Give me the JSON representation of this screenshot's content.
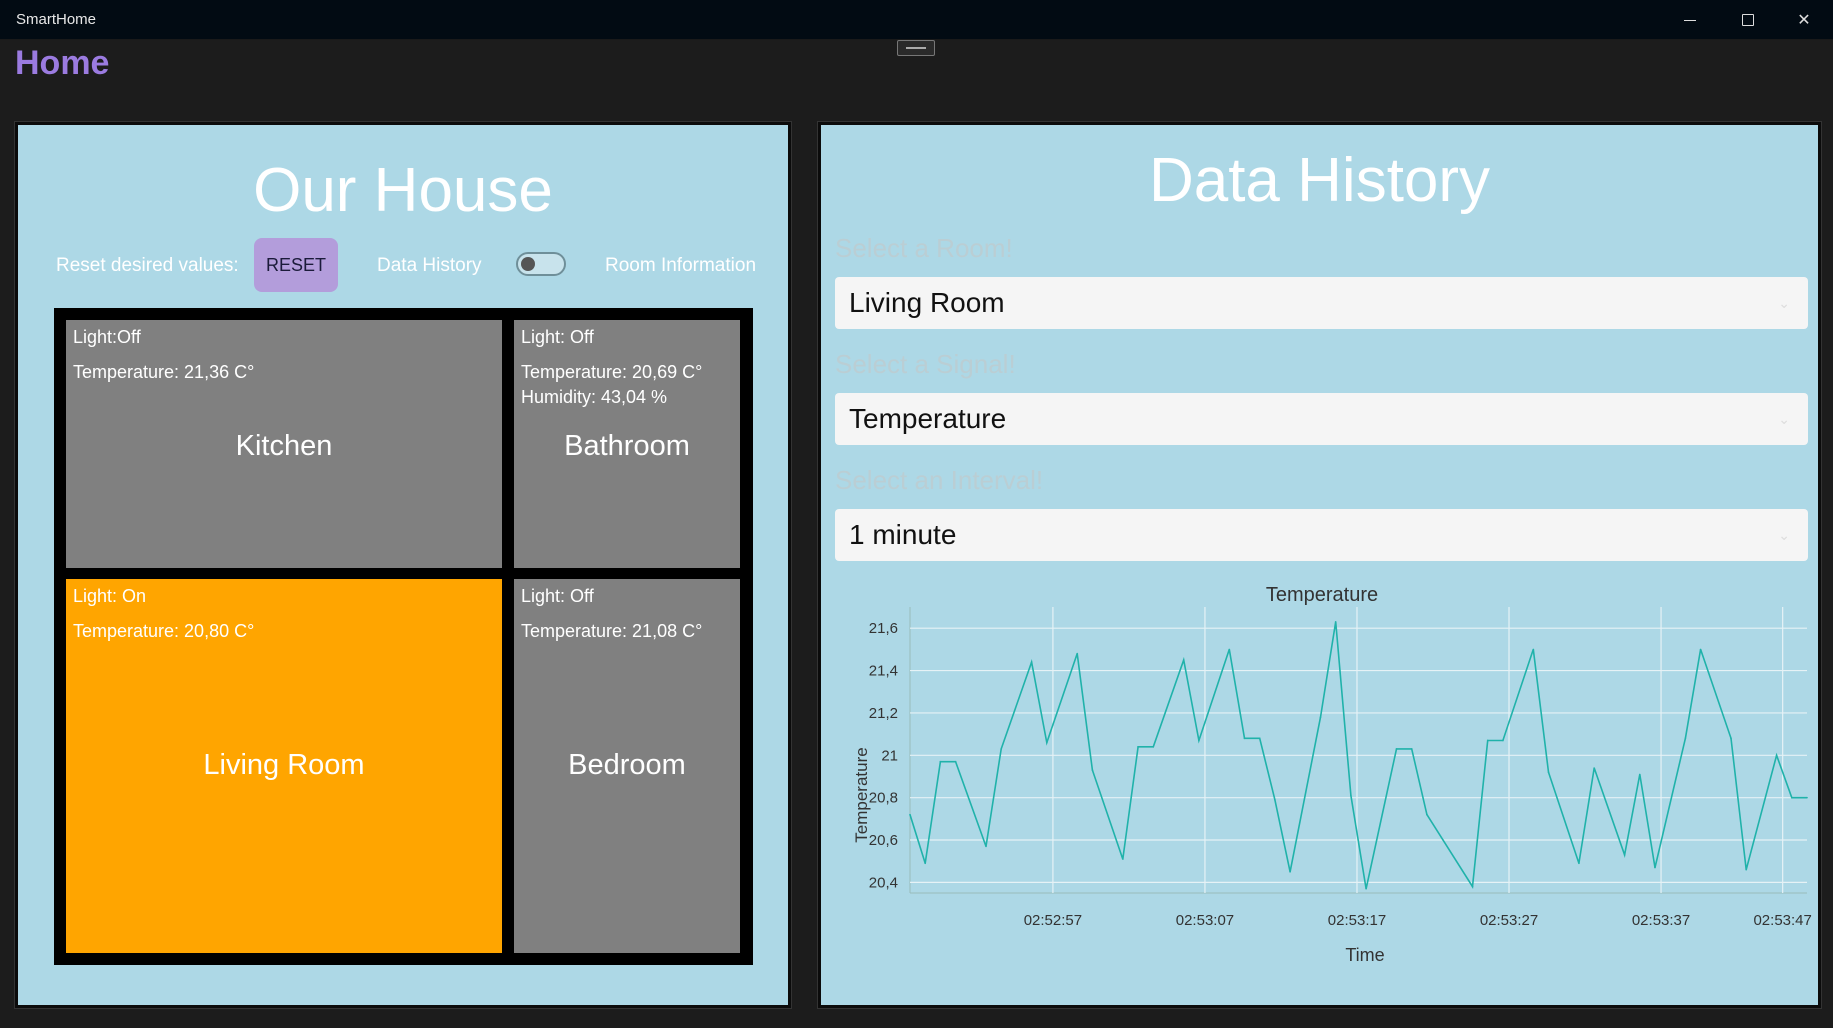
{
  "window": {
    "title": "SmartHome",
    "minimize_icon": "minimize-icon",
    "maximize_icon": "maximize-icon",
    "close_icon": "close-icon",
    "close_glyph": "✕"
  },
  "page": {
    "title": "Home"
  },
  "house": {
    "title": "Our House",
    "reset_label": "Reset desired values:",
    "reset_button": "RESET",
    "data_history_label": "Data History",
    "room_information_label": "Room Information",
    "toggle_state": "off",
    "rooms": [
      {
        "id": "kitchen",
        "light": "Light:Off",
        "temperature": "Temperature: 21,36 C°",
        "humidity": "",
        "name": "Kitchen",
        "light_on": false
      },
      {
        "id": "bathroom",
        "light": "Light:  Off",
        "temperature": "Temperature: 20,69 C°",
        "humidity": "Humidity: 43,04 %",
        "name": "Bathroom",
        "light_on": false
      },
      {
        "id": "living",
        "light": "Light:  On",
        "temperature": "Temperature: 20,80 C°",
        "humidity": "",
        "name": "Living Room",
        "light_on": true
      },
      {
        "id": "bedroom",
        "light": "Light:  Off",
        "temperature": "Temperature: 21,08 C°",
        "humidity": "",
        "name": "Bedroom",
        "light_on": false
      }
    ],
    "colors": {
      "light_on": "#ffa500",
      "light_off": "#808080",
      "panel": "#add8e6",
      "reset_button": "#b39ddb"
    }
  },
  "history": {
    "title": "Data History",
    "room_label": "Select a Room!",
    "room_value": "Living Room",
    "signal_label": "Select a Signal!",
    "signal_value": "Temperature",
    "interval_label": "Select an Interval!",
    "interval_value": "1 minute"
  },
  "chart_data": {
    "type": "line",
    "title": "Temperature",
    "xlabel": "Time",
    "ylabel": "Temperature",
    "ylim": [
      20.35,
      21.7
    ],
    "yticks": [
      "20,4",
      "20,6",
      "20,8",
      "21",
      "21,2",
      "21,4",
      "21,6"
    ],
    "ytick_values": [
      20.4,
      20.6,
      20.8,
      21.0,
      21.2,
      21.4,
      21.6
    ],
    "xlim": [
      0,
      59
    ],
    "xtick_labels": [
      "02:52:57",
      "02:53:07",
      "02:53:17",
      "02:53:27",
      "02:53:37",
      "02:53:47"
    ],
    "xtick_values": [
      9.4,
      19.4,
      29.4,
      39.4,
      49.4,
      57.4
    ],
    "grid": true,
    "color": "#20b2aa",
    "x": [
      0,
      1,
      2,
      3,
      5,
      6,
      8,
      9,
      11,
      12,
      14,
      15,
      16,
      18,
      19,
      21,
      22,
      23,
      24,
      25,
      27,
      28,
      29,
      30,
      32,
      33,
      34,
      37,
      38,
      39,
      41,
      42,
      44,
      45,
      47,
      48,
      49,
      51,
      52,
      54,
      55,
      57,
      58,
      59
    ],
    "y": [
      20.72,
      20.49,
      20.97,
      20.97,
      20.57,
      21.03,
      21.44,
      21.06,
      21.48,
      20.93,
      20.51,
      21.04,
      21.04,
      21.45,
      21.07,
      21.5,
      21.08,
      21.08,
      20.79,
      20.45,
      21.18,
      21.63,
      20.81,
      20.37,
      21.03,
      21.03,
      20.72,
      20.38,
      21.07,
      21.07,
      21.5,
      20.92,
      20.49,
      20.94,
      20.53,
      20.91,
      20.47,
      21.08,
      21.5,
      21.08,
      20.46,
      21.0,
      20.8,
      20.8
    ]
  }
}
